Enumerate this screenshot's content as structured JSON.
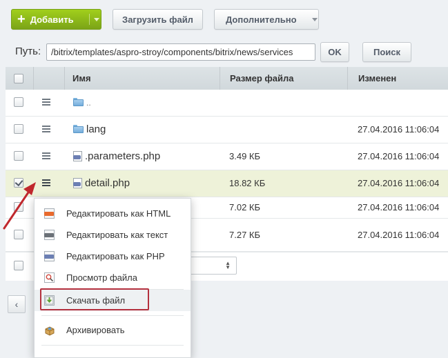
{
  "toolbar": {
    "add_label": "Добавить",
    "upload_label": "Загрузить файл",
    "more_label": "Дополнительно"
  },
  "path": {
    "label": "Путь:",
    "value": "/bitrix/templates/aspro-stroy/components/bitrix/news/services",
    "ok_label": "OK",
    "search_label": "Поиск"
  },
  "table": {
    "columns": {
      "name": "Имя",
      "size": "Размер файла",
      "modified": "Изменен"
    },
    "rows": [
      {
        "name": "..",
        "size": "",
        "date": "",
        "type": "folder-up",
        "checked": false
      },
      {
        "name": "lang",
        "size": "",
        "date": "27.04.2016 11:06:04",
        "type": "folder",
        "checked": false
      },
      {
        "name": ".parameters.php",
        "size": "3.49 КБ",
        "date": "27.04.2016 11:06:04",
        "type": "php",
        "checked": false
      },
      {
        "name": "detail.php",
        "size": "18.82 КБ",
        "date": "27.04.2016 11:06:04",
        "type": "php",
        "checked": true
      },
      {
        "name": "",
        "size": "7.02 КБ",
        "date": "27.04.2016 11:06:04",
        "type": "php",
        "checked": false
      },
      {
        "name": "",
        "size": "7.27 КБ",
        "date": "27.04.2016 11:06:04",
        "type": "php",
        "checked": false
      }
    ]
  },
  "context_menu": {
    "items": [
      {
        "label": "Редактировать как HTML",
        "icon": "html-edit-icon"
      },
      {
        "label": "Редактировать как текст",
        "icon": "txt-edit-icon"
      },
      {
        "label": "Редактировать как PHP",
        "icon": "php-edit-icon"
      },
      {
        "label": "Просмотр файла",
        "icon": "view-file-icon"
      },
      {
        "label": "Скачать файл",
        "icon": "download-icon"
      },
      {
        "label": "Архивировать",
        "icon": "archive-icon"
      }
    ]
  },
  "pager": {
    "prev_label": "‹"
  },
  "colors": {
    "add_button": "#8ab81a",
    "selected_row": "#eef2d9",
    "highlight": "#b4303d",
    "arrow": "#c0282d"
  }
}
